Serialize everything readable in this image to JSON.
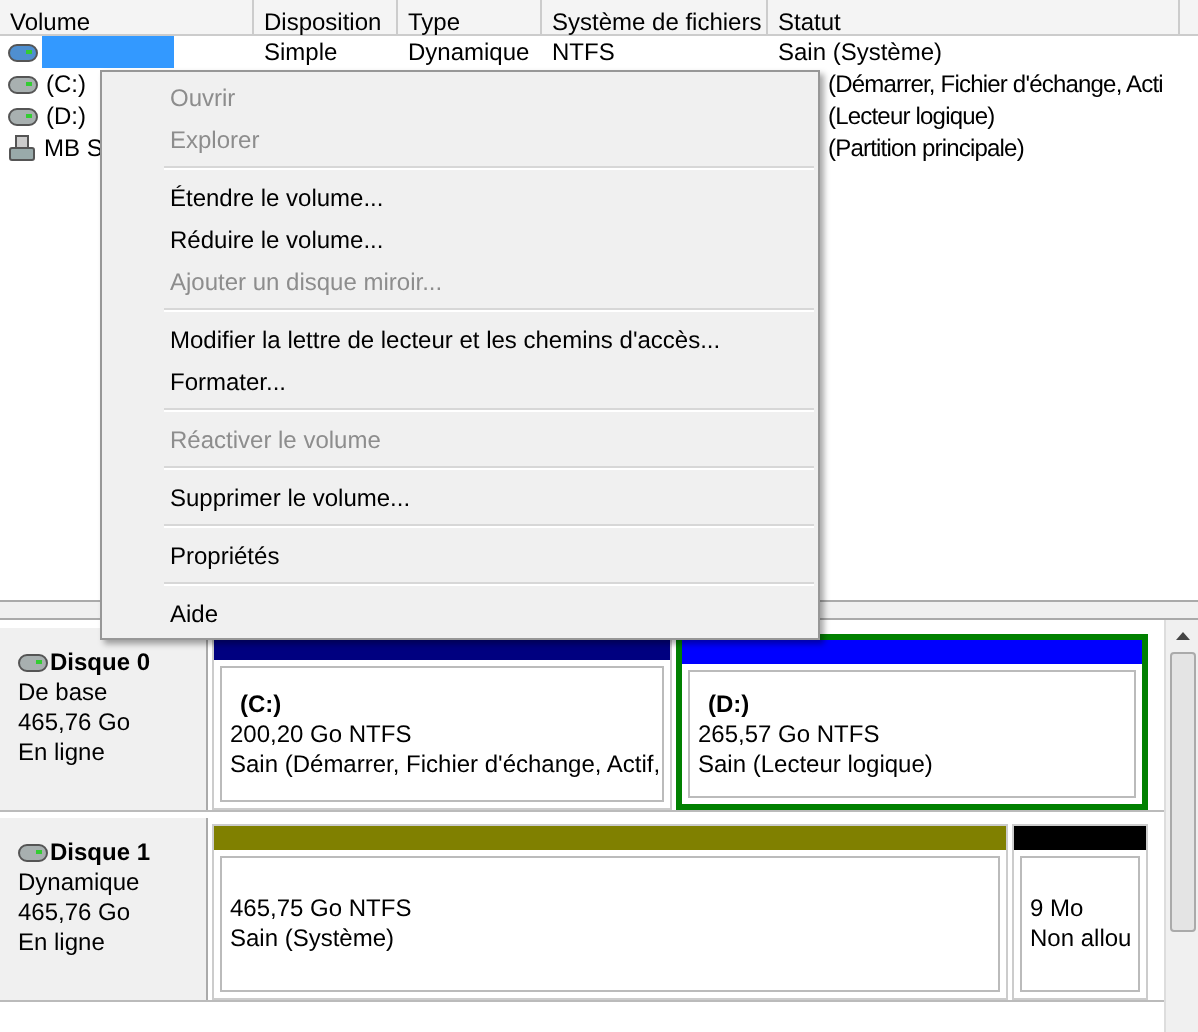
{
  "columns": [
    "Volume",
    "Disposition",
    "Type",
    "Système de fichiers",
    "Statut"
  ],
  "volumes": [
    {
      "selected": true,
      "cells": [
        "Simple",
        "Dynamique",
        "NTFS",
        "Sain (Système)"
      ]
    },
    {
      "name": "(C:)",
      "selected": false,
      "cells": [
        "",
        "",
        "",
        "(Démarrer, Fichier d'échange, Acti"
      ]
    },
    {
      "name": "(D:)",
      "selected": false,
      "cells": [
        "",
        "",
        "",
        "(Lecteur logique)"
      ]
    },
    {
      "name": "MB S",
      "selected": false,
      "cells": [
        "",
        "",
        "",
        "(Partition principale)"
      ]
    }
  ],
  "context_menu": [
    {
      "kind": "item",
      "label": "Ouvrir",
      "disabled": true
    },
    {
      "kind": "item",
      "label": "Explorer",
      "disabled": true
    },
    {
      "kind": "separator"
    },
    {
      "kind": "item",
      "label": "Étendre le volume...",
      "disabled": false
    },
    {
      "kind": "item",
      "label": "Réduire le volume...",
      "disabled": false
    },
    {
      "kind": "item",
      "label": "Ajouter un disque miroir...",
      "disabled": true
    },
    {
      "kind": "separator"
    },
    {
      "kind": "item",
      "label": "Modifier la lettre de lecteur et les chemins d'accès...",
      "disabled": false
    },
    {
      "kind": "item",
      "label": "Formater...",
      "disabled": false
    },
    {
      "kind": "separator"
    },
    {
      "kind": "item",
      "label": "Réactiver le volume",
      "disabled": true
    },
    {
      "kind": "separator"
    },
    {
      "kind": "item",
      "label": "Supprimer le volume...",
      "disabled": false
    },
    {
      "kind": "separator"
    },
    {
      "kind": "item",
      "label": "Propriétés",
      "disabled": false
    },
    {
      "kind": "separator"
    },
    {
      "kind": "item",
      "label": "Aide",
      "disabled": false
    }
  ],
  "disks": [
    {
      "name": "Disque 0",
      "type": "De base",
      "size": "465,76 Go",
      "state": "En ligne",
      "partitions": [
        {
          "label": "(C:)",
          "size": "200,20 Go NTFS",
          "status": "Sain (Démarrer, Fichier d'échange, Actif,",
          "color": "#000080",
          "selected": false
        },
        {
          "label": "(D:)",
          "size": "265,57 Go NTFS",
          "status": "Sain (Lecteur logique)",
          "color": "#0000ff",
          "selected": true
        }
      ]
    },
    {
      "name": "Disque 1",
      "type": "Dynamique",
      "size": "465,76 Go",
      "state": "En ligne",
      "partitions": [
        {
          "size": "465,75 Go NTFS",
          "status": "Sain (Système)",
          "color": "#808000",
          "selected": false
        },
        {
          "size": "9 Mo",
          "status": "Non allou",
          "color": "#000000",
          "selected": false
        }
      ]
    }
  ]
}
